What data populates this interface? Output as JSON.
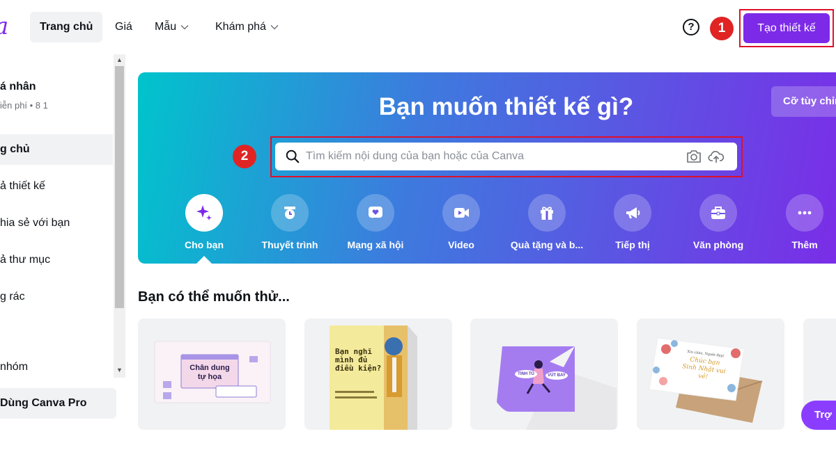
{
  "brand": {
    "logo_text": "a",
    "accent": "#7d2ae8"
  },
  "nav": {
    "items": [
      {
        "label": "Trang chủ"
      },
      {
        "label": "Giá"
      },
      {
        "label": "Mẫu"
      },
      {
        "label": "Khám phá"
      }
    ],
    "help_icon": "?",
    "create_button": "Tạo thiết kế"
  },
  "annotations": {
    "badge_1": "1",
    "badge_2": "2"
  },
  "sidebar": {
    "team_name": "á nhân",
    "team_sub": "iễn phí • 8 1",
    "items": [
      {
        "label": "g chủ"
      },
      {
        "label": "ả thiết kế"
      },
      {
        "label": "hia sẻ với bạn"
      },
      {
        "label": "ả thư mục"
      },
      {
        "label": "g rác"
      },
      {
        "label": "nhóm"
      }
    ],
    "pro_button": "Dùng Canva Pro"
  },
  "hero": {
    "title": "Bạn muốn thiết kế gì?",
    "custom_size_button": "Cỡ tùy chỉnh",
    "search": {
      "placeholder": "Tìm kiếm nội dung của bạn hoặc của Canva",
      "value": ""
    },
    "categories": [
      {
        "label": "Cho bạn",
        "icon": "sparkles-icon"
      },
      {
        "label": "Thuyết trình",
        "icon": "presentation-icon"
      },
      {
        "label": "Mạng xã hội",
        "icon": "heart-icon"
      },
      {
        "label": "Video",
        "icon": "video-icon"
      },
      {
        "label": "Quà tặng và b...",
        "icon": "gift-icon"
      },
      {
        "label": "Tiếp thị",
        "icon": "megaphone-icon"
      },
      {
        "label": "Văn phòng",
        "icon": "briefcase-icon"
      },
      {
        "label": "Thêm",
        "icon": "more-icon"
      }
    ]
  },
  "suggestions": {
    "title": "Bạn có thể muốn thử...",
    "cards": [
      {
        "text_line1": "Chân dung",
        "text_line2": "tự họa"
      },
      {
        "text_line1": "Bạn nghĩ",
        "text_line2": "mình đủ",
        "text_line3": "điều kiện?"
      },
      {
        "text_line1": "TINH TÚ",
        "text_line2": "VÚT BAY"
      },
      {
        "text_line1": "Xin chào, Người đẹp!",
        "text_line2": "Chúc bạn",
        "text_line3": "Sinh Nhật vui vẻ!"
      }
    ]
  },
  "help_button": "Trợ giúp"
}
